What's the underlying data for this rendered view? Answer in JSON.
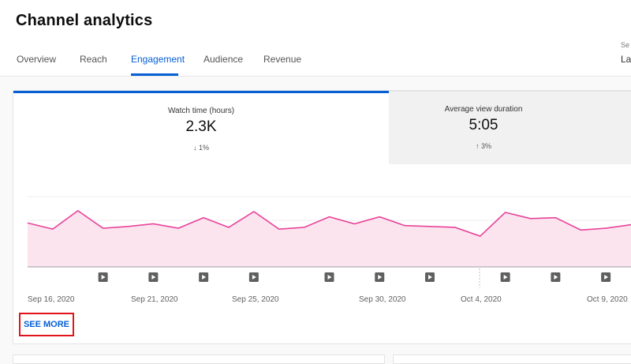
{
  "header": {
    "title": "Channel analytics",
    "tabs": [
      {
        "label": "Overview",
        "active": false
      },
      {
        "label": "Reach",
        "active": false
      },
      {
        "label": "Engagement",
        "active": true
      },
      {
        "label": "Audience",
        "active": false
      },
      {
        "label": "Revenue",
        "active": false
      }
    ],
    "right_label_top": "Se",
    "right_label_bottom": "La"
  },
  "metrics": [
    {
      "label": "Watch time (hours)",
      "value": "2.3K",
      "change": "1%",
      "direction": "down",
      "arrow": "↓"
    },
    {
      "label": "Average view duration",
      "value": "5:05",
      "change": "3%",
      "direction": "up",
      "arrow": "↑"
    }
  ],
  "see_more_label": "SEE MORE",
  "colors": {
    "accent": "#065fd4",
    "line": "#e8439a",
    "fill": "#fce4ef",
    "highlight_box": "#e0141b"
  },
  "chart_data": {
    "type": "line",
    "series": [
      {
        "values": [
          50,
          43,
          64,
          44,
          46,
          49,
          44,
          56,
          45,
          63,
          43,
          45,
          57,
          49,
          57,
          47,
          46,
          45,
          35,
          62,
          55,
          56,
          42,
          44,
          48
        ]
      }
    ],
    "x_ticks": [
      "Sep 16, 2020",
      "Sep 21, 2020",
      "Sep 25, 2020",
      "Sep 30, 2020",
      "Oct 4, 2020",
      "Oct 9, 2020"
    ],
    "marker_icon": "play-icon",
    "marker_index": [
      3,
      5,
      7,
      9,
      12,
      14,
      16,
      19,
      21,
      23
    ]
  }
}
